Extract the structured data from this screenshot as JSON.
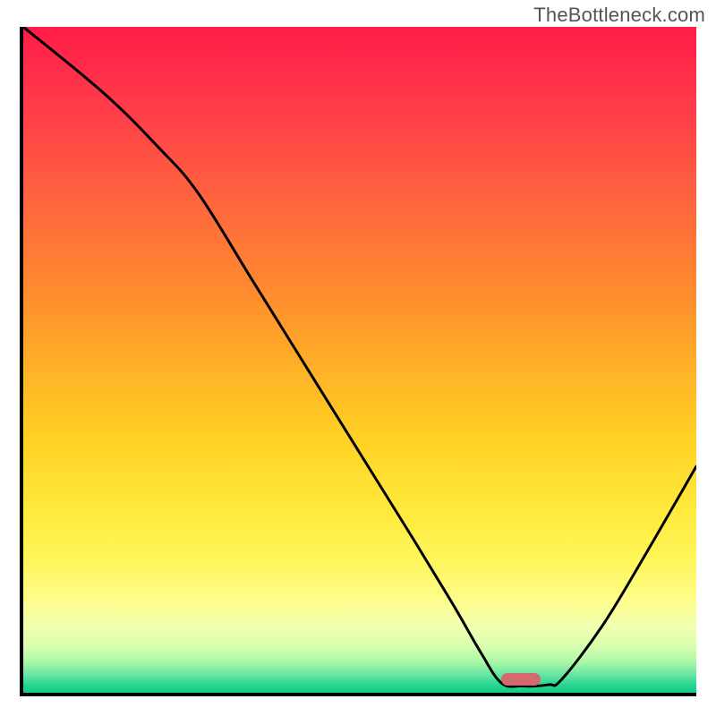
{
  "watermark": "TheBottleneck.com",
  "colors": {
    "gradient_top": "#ff1c48",
    "gradient_mid": "#ffd225",
    "gradient_bottom": "#14cc86",
    "curve": "#000000",
    "marker": "#d46a6f",
    "axis": "#000000"
  },
  "chart_data": {
    "type": "line",
    "title": "",
    "xlabel": "",
    "ylabel": "",
    "xlim": [
      0,
      100
    ],
    "ylim": [
      0,
      100
    ],
    "grid": false,
    "series": [
      {
        "name": "bottleneck-curve",
        "x": [
          0,
          12,
          20,
          26,
          34,
          42,
          50,
          58,
          64,
          68,
          71,
          74,
          78,
          80,
          86,
          92,
          100
        ],
        "values": [
          100,
          90,
          82,
          75,
          62,
          49,
          36,
          23,
          13,
          6,
          1.5,
          1,
          1.2,
          2,
          10,
          20,
          34
        ]
      }
    ],
    "annotations": [
      {
        "name": "optimal-marker",
        "x": 74,
        "y": 2,
        "shape": "pill",
        "color": "#d46a6f"
      }
    ]
  }
}
